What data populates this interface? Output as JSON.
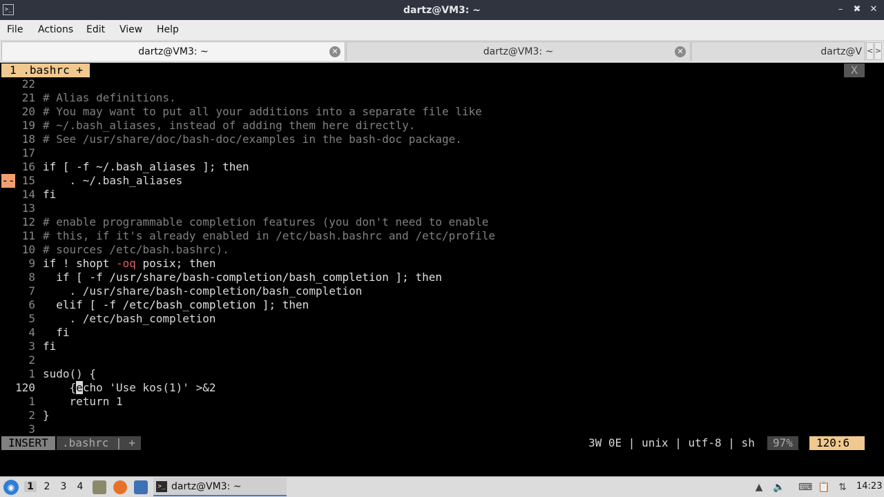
{
  "window": {
    "title": "dartz@VM3: ~",
    "minimize": "–",
    "maximize": "✖",
    "close": "✕",
    "app_icon": ">_"
  },
  "menu": [
    "File",
    "Actions",
    "Edit",
    "View",
    "Help"
  ],
  "tabs": [
    {
      "label": "dartz@VM3: ~",
      "close": "✕"
    },
    {
      "label": "dartz@VM3: ~",
      "close": "✕"
    },
    {
      "label": "dartz@V",
      "close": ""
    }
  ],
  "tab_scroll": {
    "left": "<",
    "right": ">"
  },
  "vim": {
    "buffer_tab": "1 .bashrc +",
    "buffer_close": "X",
    "lines": [
      {
        "num": "22",
        "code": "",
        "cls": ""
      },
      {
        "num": "21",
        "code": "# Alias definitions.",
        "cls": "c-comment"
      },
      {
        "num": "20",
        "code": "# You may want to put all your additions into a separate file like",
        "cls": "c-comment"
      },
      {
        "num": "19",
        "code": "# ~/.bash_aliases, instead of adding them here directly.",
        "cls": "c-comment"
      },
      {
        "num": "18",
        "code": "# See /usr/share/doc/bash-doc/examples in the bash-doc package.",
        "cls": "c-comment"
      },
      {
        "num": "17",
        "code": "",
        "cls": ""
      },
      {
        "num": "16",
        "code": "if [ -f ~/.bash_aliases ]; then",
        "cls": "c-kw"
      },
      {
        "num": "15",
        "code": "    . ~/.bash_aliases",
        "cls": "",
        "sign": "--"
      },
      {
        "num": "14",
        "code": "fi",
        "cls": "c-kw"
      },
      {
        "num": "13",
        "code": "",
        "cls": ""
      },
      {
        "num": "12",
        "code": "# enable programmable completion features (you don't need to enable",
        "cls": "c-comment"
      },
      {
        "num": "11",
        "code": "# this, if it's already enabled in /etc/bash.bashrc and /etc/profile",
        "cls": "c-comment"
      },
      {
        "num": "10",
        "code": "# sources /etc/bash.bashrc).",
        "cls": "c-comment"
      },
      {
        "num": "9",
        "code": "if ! shopt -oq posix; then",
        "cls": "c-kw"
      },
      {
        "num": "8",
        "code": "  if [ -f /usr/share/bash-completion/bash_completion ]; then",
        "cls": "c-kw"
      },
      {
        "num": "7",
        "code": "    . /usr/share/bash-completion/bash_completion",
        "cls": ""
      },
      {
        "num": "6",
        "code": "  elif [ -f /etc/bash_completion ]; then",
        "cls": "c-kw"
      },
      {
        "num": "5",
        "code": "    . /etc/bash_completion",
        "cls": ""
      },
      {
        "num": "4",
        "code": "  fi",
        "cls": "c-kw"
      },
      {
        "num": "3",
        "code": "fi",
        "cls": "c-kw"
      },
      {
        "num": "2",
        "code": "",
        "cls": ""
      },
      {
        "num": "1",
        "code": "sudo() {",
        "cls": ""
      },
      {
        "num": "120",
        "code_pre": "    {",
        "cursor_char": "e",
        "code_post": "cho 'Use kos(1)' >&2",
        "current": true
      },
      {
        "num": "1",
        "code": "    return 1",
        "cls": ""
      },
      {
        "num": "2",
        "code": "}",
        "cls": ""
      },
      {
        "num": "3",
        "code": "",
        "cls": ""
      }
    ],
    "status": {
      "mode": "INSERT",
      "file": ".bashrc | +",
      "info": "3W 0E | unix | utf-8 | sh",
      "percent": "97%",
      "position": "120:6"
    }
  },
  "taskbar": {
    "workspaces": [
      "1",
      "2",
      "3",
      "4"
    ],
    "active_workspace": "1",
    "task_label": "dartz@VM3: ~",
    "clock": "14:23"
  }
}
